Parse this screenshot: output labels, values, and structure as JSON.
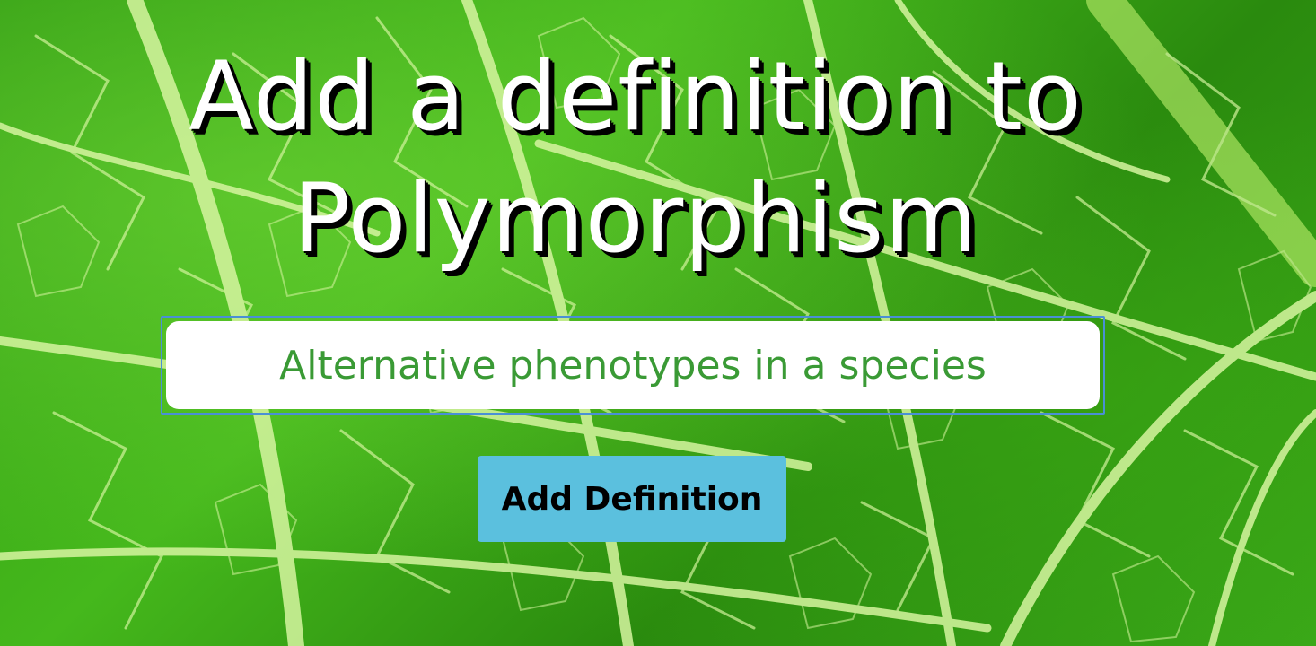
{
  "page": {
    "title_line1": "Add a definition to",
    "title_line2": "Polymorphism",
    "background": "leaf-veins-photo"
  },
  "form": {
    "definition_value": "Alternative phenotypes in a species",
    "definition_placeholder": "",
    "submit_label": "Add Definition"
  },
  "colors": {
    "button_bg": "#5bc0de",
    "input_text": "#3a9a35",
    "input_focus_border": "#4a8fd6",
    "title_text": "#ffffff",
    "title_shadow": "#000000"
  }
}
